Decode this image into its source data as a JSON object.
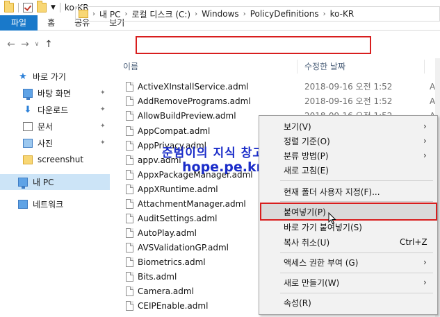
{
  "window": {
    "title": "ko-KR"
  },
  "ribbon": {
    "tabs": [
      "파일",
      "홈",
      "공유",
      "보기"
    ]
  },
  "address": {
    "crumbs": [
      "내 PC",
      "로컬 디스크 (C:)",
      "Windows",
      "PolicyDefinitions",
      "ko-KR"
    ]
  },
  "nav": {
    "items": [
      {
        "label": "바로 가기",
        "icon": "star-icon"
      },
      {
        "label": "바탕 화면",
        "icon": "desktop-icon"
      },
      {
        "label": "다운로드",
        "icon": "download-icon"
      },
      {
        "label": "문서",
        "icon": "document-icon"
      },
      {
        "label": "사진",
        "icon": "pictures-icon"
      },
      {
        "label": "screenshut",
        "icon": "folder-icon"
      },
      {
        "label": "내 PC",
        "icon": "pc-icon"
      },
      {
        "label": "네트워크",
        "icon": "network-icon"
      }
    ]
  },
  "columns": {
    "name": "이름",
    "date": "수정한 날짜"
  },
  "files": [
    {
      "name": "ActiveXInstallService.adml",
      "date": "2018-09-16 오전 1:52",
      "type": "AD"
    },
    {
      "name": "AddRemovePrograms.adml",
      "date": "2018-09-16 오전 1:52",
      "type": "AD"
    },
    {
      "name": "AllowBuildPreview.adml",
      "date": "2018-09-16 오전 1:52",
      "type": "AD"
    },
    {
      "name": "AppCompat.adml",
      "date": "",
      "type": ""
    },
    {
      "name": "AppPrivacy.adml",
      "date": "",
      "type": ""
    },
    {
      "name": "appv.adml",
      "date": "",
      "type": ""
    },
    {
      "name": "AppxPackageManager.adml",
      "date": "",
      "type": ""
    },
    {
      "name": "AppXRuntime.adml",
      "date": "",
      "type": ""
    },
    {
      "name": "AttachmentManager.adml",
      "date": "",
      "type": ""
    },
    {
      "name": "AuditSettings.adml",
      "date": "",
      "type": ""
    },
    {
      "name": "AutoPlay.adml",
      "date": "",
      "type": ""
    },
    {
      "name": "AVSValidationGP.adml",
      "date": "",
      "type": ""
    },
    {
      "name": "Biometrics.adml",
      "date": "",
      "type": ""
    },
    {
      "name": "Bits.adml",
      "date": "",
      "type": ""
    },
    {
      "name": "Camera.adml",
      "date": "",
      "type": ""
    },
    {
      "name": "CEIPEnable.adml",
      "date": "",
      "type": ""
    }
  ],
  "watermark": {
    "line1": "준범이의 지식 창고..",
    "line2": "hope.pe.kr"
  },
  "context_menu": {
    "items": [
      {
        "label": "보기(V)",
        "shortcut": "",
        "submenu": true
      },
      {
        "label": "정렬 기준(O)",
        "shortcut": "",
        "submenu": true
      },
      {
        "label": "분류 방법(P)",
        "shortcut": "",
        "submenu": true
      },
      {
        "label": "새로 고침(E)",
        "shortcut": "",
        "submenu": false
      },
      {
        "label": "현재 폴더 사용자 지정(F)...",
        "shortcut": "",
        "submenu": false
      },
      {
        "label": "붙여넣기(P)",
        "shortcut": "",
        "submenu": false
      },
      {
        "label": "바로 가기 붙여넣기(S)",
        "shortcut": "",
        "submenu": false
      },
      {
        "label": "복사 취소(U)",
        "shortcut": "Ctrl+Z",
        "submenu": false
      },
      {
        "label": "액세스 권한 부여 (G)",
        "shortcut": "",
        "submenu": true
      },
      {
        "label": "새로 만들기(W)",
        "shortcut": "",
        "submenu": true
      },
      {
        "label": "속성(R)",
        "shortcut": "",
        "submenu": false
      }
    ]
  },
  "colors": {
    "accent": "#1979ca",
    "highlight_red": "#d81e1e",
    "watermark_blue": "#1a2cc9"
  }
}
